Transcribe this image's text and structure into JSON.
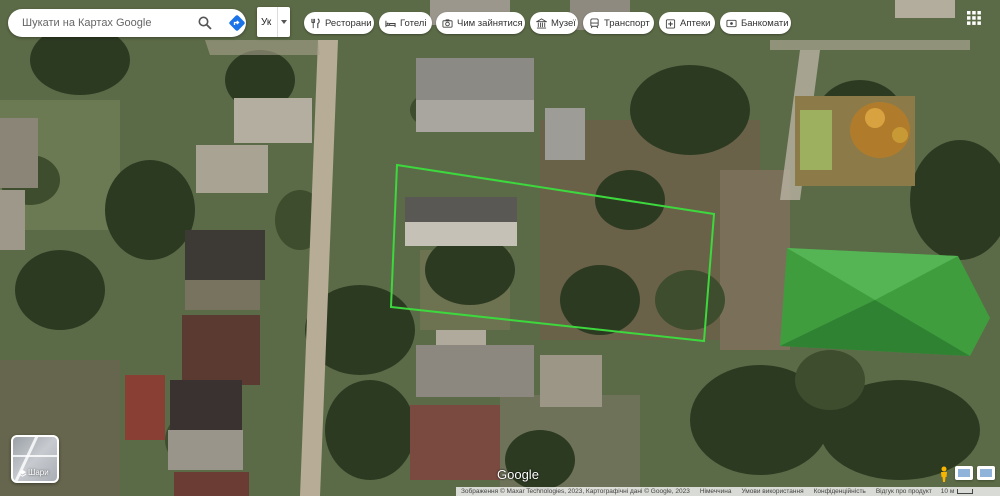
{
  "search": {
    "placeholder": "Шукати на Картах Google"
  },
  "language": {
    "label": "Ук"
  },
  "chips": [
    {
      "label": "Ресторани",
      "icon": "restaurant-icon"
    },
    {
      "label": "Готелі",
      "icon": "hotel-icon"
    },
    {
      "label": "Чим зайнятися",
      "icon": "camera-icon"
    },
    {
      "label": "Музеї",
      "icon": "museum-icon"
    },
    {
      "label": "Транспорт",
      "icon": "transit-icon"
    },
    {
      "label": "Аптеки",
      "icon": "pharmacy-icon"
    },
    {
      "label": "Банкомати",
      "icon": "atm-icon"
    }
  ],
  "layers": {
    "label": "Шари"
  },
  "logo": "Google",
  "attribution": {
    "imagery": "Зображення © Maxar Technologies, 2023,  Картографічні дані © Google, 2023",
    "links": [
      "Німеччина",
      "Умови використання",
      "Конфіденційність",
      "Відгук про продукт"
    ],
    "scale": "10 м"
  },
  "colors": {
    "parcel_outline": "#3dd83d",
    "green_roof": "#3f9d3e"
  }
}
